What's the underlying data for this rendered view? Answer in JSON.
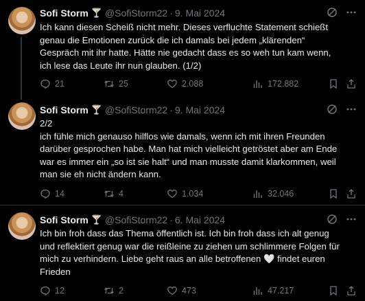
{
  "tweets": [
    {
      "name": "Sofi Storm",
      "badge": "🍸",
      "handle": "@SofiStorm22",
      "separator": "·",
      "date": "9. Mai 2024",
      "text_lines": [
        "Ich kann diesen Scheiß nicht mehr. Dieses verfluchte  Statement schießt",
        "genau die Emotionen zurück die ich damals bei jedem „klärenden“",
        "Gespräch mit ihr hatte. Hätte nie gedacht dass es so weh tun kam wenn,",
        "ich lese das Leute ihr nun glauben. (1/2)"
      ],
      "replies": "21",
      "retweets": "25",
      "likes": "2.088",
      "views": "172.882"
    },
    {
      "name": "Sofi Storm",
      "badge": "🍸",
      "handle": "@SofiStorm22",
      "separator": "·",
      "date": "9. Mai 2024",
      "text_lines": [
        "2/2",
        "ich fühle mich genauso hilflos wie damals, wenn ich mit ihren Freunden",
        "darüber gesprochen habe. Man hat mich vielleicht getröstet aber am Ende",
        "war es immer ein „so ist sie halt“ und man musste damit klarkommen, weil",
        "man sie eh nicht ändern kann."
      ],
      "replies": "14",
      "retweets": "4",
      "likes": "1.034",
      "views": "32.046"
    },
    {
      "name": "Sofi Storm",
      "badge": "🍸",
      "handle": "@SofiStorm22",
      "separator": "·",
      "date": "6. Mai 2024",
      "text_lines": [
        "Ich bin froh dass das Thema öffentlich ist. Ich bin froh dass ich alt genug",
        "und reflektiert genug war die reißleine zu ziehen um schlimmere Folgen für",
        "mich zu verhindern. Liebe geht raus an alle betroffenen",
        "Frieden"
      ],
      "line3_suffix": "findet euren",
      "heart_emoji": "🤍",
      "replies": "12",
      "retweets": "2",
      "likes": "473",
      "views": "47.217"
    }
  ],
  "icons": {
    "grok": "grok-icon",
    "more": "more-icon",
    "reply": "reply-icon",
    "retweet": "retweet-icon",
    "like": "like-icon",
    "views": "views-icon",
    "bookmark": "bookmark-icon",
    "share": "share-icon"
  },
  "colors": {
    "background": "#000000",
    "text": "#e7e9ea",
    "muted": "#71767b",
    "divider": "#2f3336"
  }
}
